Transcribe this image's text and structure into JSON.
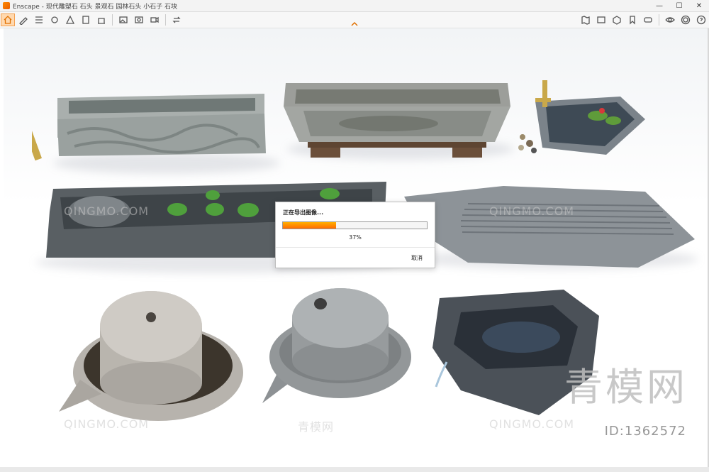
{
  "window": {
    "title": "Enscape - 现代雕塑石 石头 景观石 园林石头 小石子 石块",
    "minimize_glyph": "—",
    "maximize_glyph": "☐",
    "close_glyph": "✕"
  },
  "toolbar": {
    "left_icons": [
      "home-icon",
      "draw-icon",
      "list-icon",
      "capture-icon",
      "asset-icon",
      "book-icon",
      "building-icon",
      "export-image-icon",
      "export-panorama-icon",
      "export-video-icon",
      "sync-icon"
    ],
    "right_icons": [
      "map-icon",
      "screenshot-icon",
      "cube-icon",
      "bookmark-icon",
      "vr-icon",
      "visibility-icon",
      "settings-icon",
      "help-icon"
    ]
  },
  "dialog": {
    "title": "正在导出图像...",
    "progress_percent": 37,
    "progress_label": "37%",
    "cancel_label": "取消"
  },
  "watermark": {
    "brand_text": "QINGMO.COM",
    "cn_text": "青模网",
    "id_text": "ID:1362572",
    "big_text": "青模网"
  },
  "colors": {
    "progress_start": "#ffb000",
    "progress_end": "#ff6a00",
    "accent": "#e07000"
  }
}
